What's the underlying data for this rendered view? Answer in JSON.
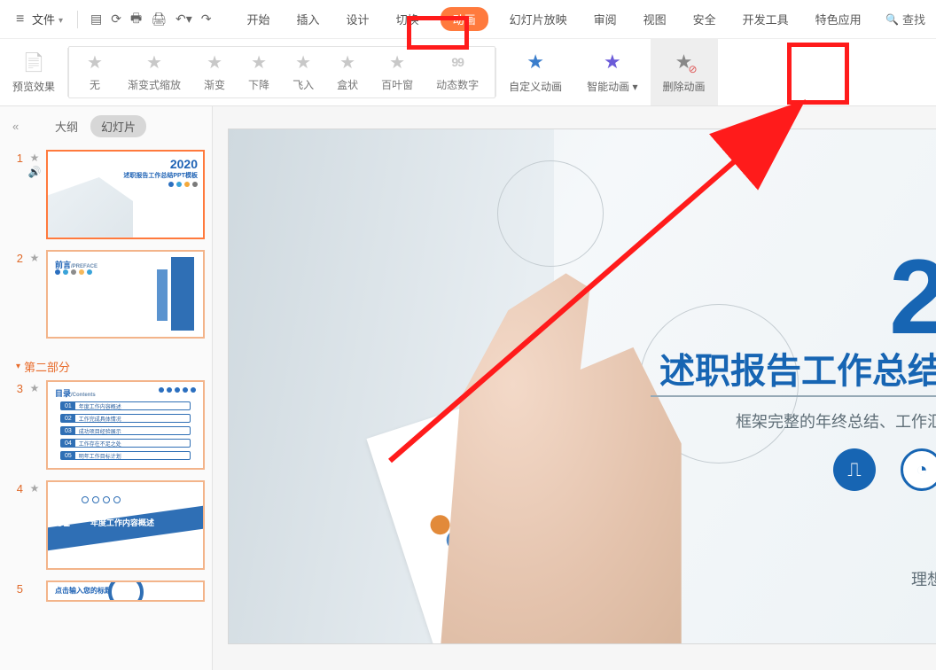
{
  "menubar": {
    "file_label": "文件",
    "search_label": "查找",
    "tabs": [
      "开始",
      "插入",
      "设计",
      "切换",
      "动画",
      "幻灯片放映",
      "审阅",
      "视图",
      "安全",
      "开发工具",
      "特色应用"
    ],
    "active_tab_index": 4
  },
  "ribbon": {
    "preview_label": "预览效果",
    "gallery": [
      "无",
      "渐变式缩放",
      "渐变",
      "下降",
      "飞入",
      "盒状",
      "百叶窗",
      "动态数字"
    ],
    "custom_anim": "自定义动画",
    "smart_anim": "智能动画",
    "delete_anim": "删除动画"
  },
  "sidepanel": {
    "outline_label": "大纲",
    "slides_label": "幻灯片",
    "section2_label": "第二部分",
    "slide1": {
      "year": "2020",
      "title": "述职报告工作总结PPT模板"
    },
    "slide2": {
      "heading": "前言",
      "heading_en": "/PREFACE"
    },
    "slide3": {
      "heading": "目录",
      "heading_en": "/Contents",
      "items": [
        "年度工作内容概述",
        "工作完成具体情况",
        "成功项目经验展示",
        "工作存在不足之处",
        "明年工作目标计划"
      ]
    },
    "slide4": {
      "num": "01",
      "label": "年度工作内容概述"
    },
    "slide5": {
      "heading": "点击输入您的标题"
    }
  },
  "slide": {
    "year_partial": "2",
    "title_partial": "述职报告工作总结",
    "subtitle_partial": "框架完整的年终总结、工作汇",
    "motto_partial": "理想"
  }
}
